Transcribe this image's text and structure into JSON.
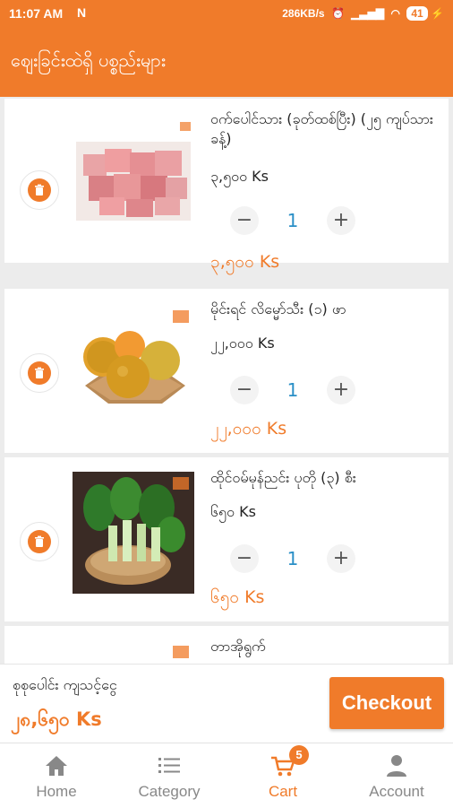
{
  "status_bar": {
    "time": "11:07 AM",
    "net_speed": "286KB/s",
    "battery": "41"
  },
  "header": {
    "title": "ဈေးခြင်းထဲရှိ ပစ္စည်းများ"
  },
  "cart_items": [
    {
      "name": "ဝက်ပေါင်သား (ခုတ်ထစ်ပြီး) (၂၅ ကျပ်သားခန့်)",
      "price": "၃,၅၀၀ Ks",
      "quantity": "1",
      "total": "၃,၅၀၀ Ks",
      "image": "pork-cubes"
    },
    {
      "name": "မိုင်းရင် လိမ္မော်သီး (၁) ဖာ",
      "price": "၂၂,၀၀၀ Ks",
      "quantity": "1",
      "total": "၂၂,၀၀၀ Ks",
      "image": "oranges"
    },
    {
      "name": "ထိုင်ဝမ်မုန်ညင်း ပုတို (၃) စီး",
      "price": "၆၅၀ Ks",
      "quantity": "1",
      "total": "၆၅၀ Ks",
      "image": "bok-choy"
    },
    {
      "name": "တာအိုရွက်",
      "image": "tao-leaves"
    }
  ],
  "controls": {
    "minus": "−",
    "plus": "+"
  },
  "summary": {
    "label": "စုစုပေါင်း ကျသင့်ငွေ",
    "amount": "၂၈,၆၅၀ Ks",
    "checkout_label": "Checkout"
  },
  "bottom_nav": {
    "items": [
      {
        "label": "Home",
        "icon": "home-icon"
      },
      {
        "label": "Category",
        "icon": "list-icon"
      },
      {
        "label": "Cart",
        "icon": "cart-icon",
        "badge": "5",
        "active": true
      },
      {
        "label": "Account",
        "icon": "person-icon"
      }
    ]
  },
  "colors": {
    "accent": "#f07b2a",
    "quantity": "#2a8fc7"
  }
}
